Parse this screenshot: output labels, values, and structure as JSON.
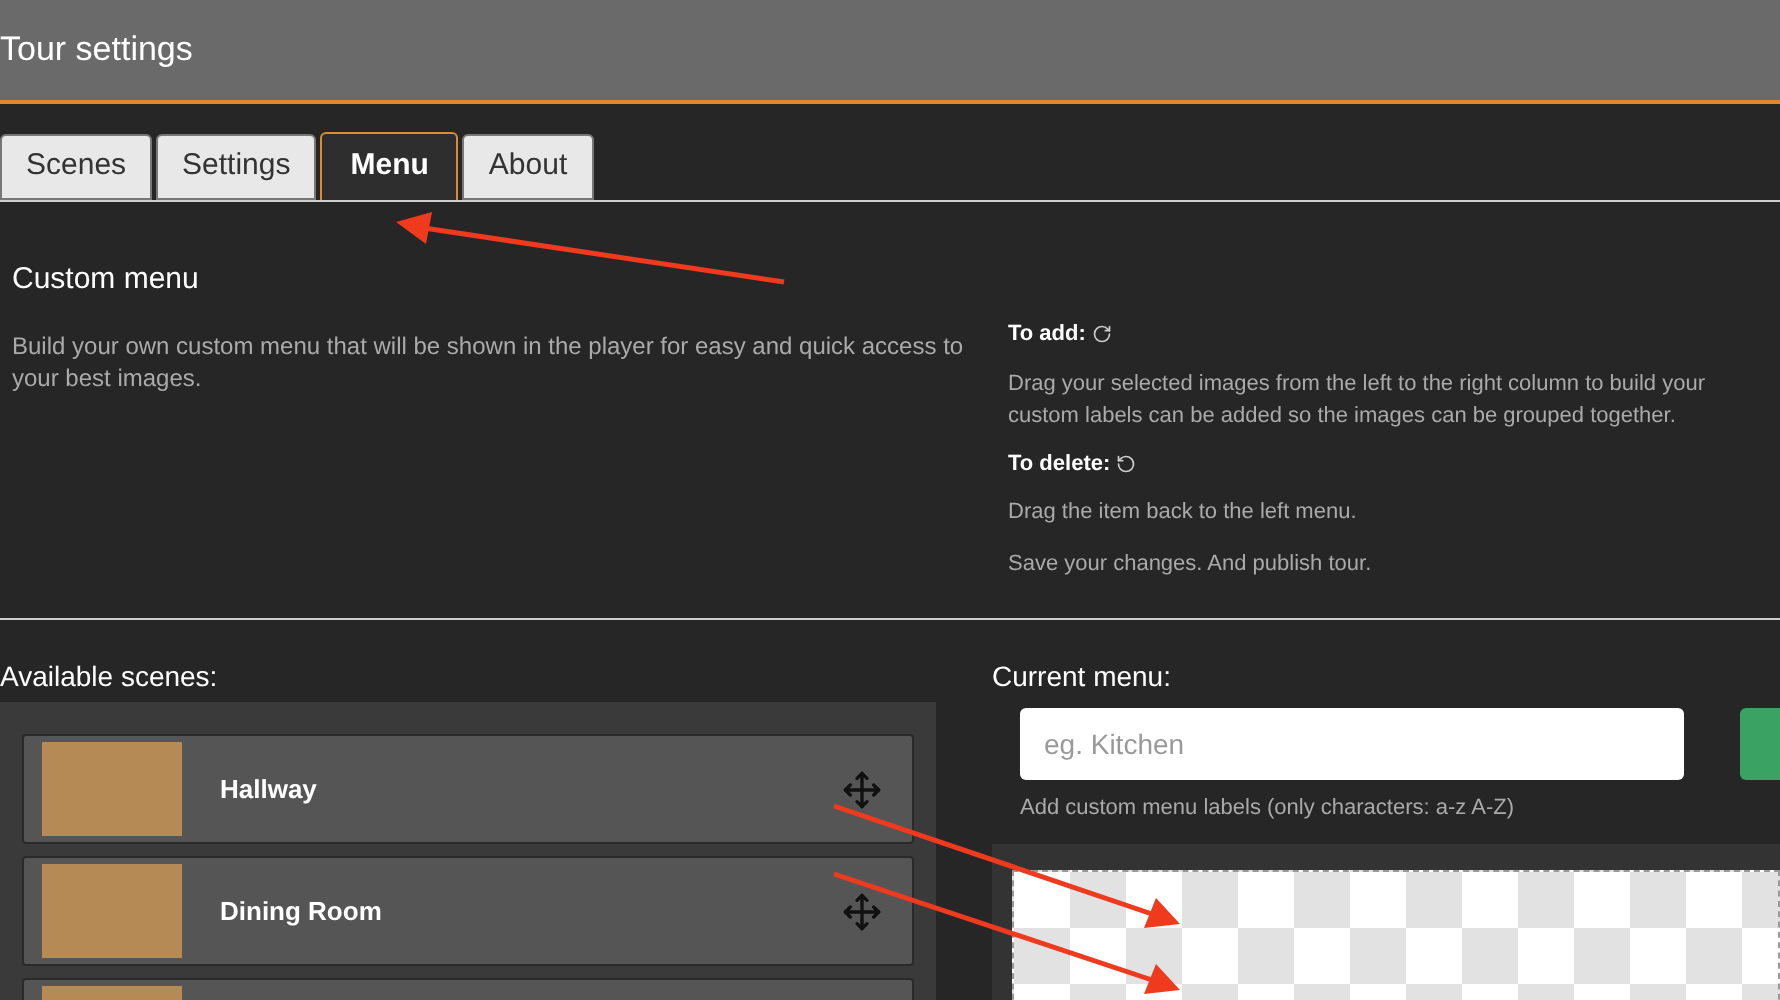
{
  "window": {
    "title": "Tour settings"
  },
  "tabs": [
    {
      "label": "Scenes",
      "selected": false
    },
    {
      "label": "Settings",
      "selected": false
    },
    {
      "label": "Menu",
      "selected": true
    },
    {
      "label": "About",
      "selected": false
    }
  ],
  "intro": {
    "heading": "Custom menu",
    "text": "Build your own custom menu that will be shown in the player for easy and quick access to your best images."
  },
  "help": [
    {
      "kind": "add",
      "title": "To add:",
      "lines": [
        "Drag your selected images from the left to the right column to build your",
        "custom labels can be added so the images can be grouped together."
      ]
    },
    {
      "kind": "delete",
      "title": "To delete:",
      "lines": [
        "Drag the item back to the left menu."
      ]
    },
    {
      "kind": "note",
      "lines": [
        "Save your changes. And publish tour."
      ]
    }
  ],
  "available": {
    "label": "Available scenes:",
    "scenes": [
      {
        "kind": "scene",
        "name": "Hallway"
      },
      {
        "kind": "scene",
        "name": "Dining Room"
      },
      {
        "kind": "partial"
      }
    ]
  },
  "current": {
    "label": "Current menu:",
    "input": {
      "placeholder": "eg. Kitchen"
    },
    "hint": "Add custom menu labels (only characters: a-z A-Z)"
  }
}
